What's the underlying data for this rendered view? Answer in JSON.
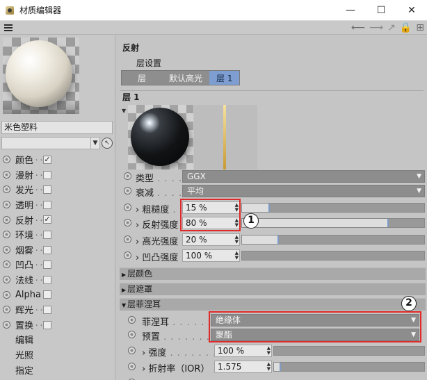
{
  "window": {
    "title": "材质编辑器",
    "minimize_glyph": "—",
    "maximize_glyph": "☐",
    "close_glyph": "✕"
  },
  "toolbar": {
    "icons": [
      "menu-icon",
      "back-arrow-icon",
      "forward-arrow-icon",
      "up-arrow-icon",
      "lock-icon",
      "new-window-icon"
    ]
  },
  "material": {
    "name": "米色塑料",
    "channels": [
      {
        "label": "颜色",
        "checked": true,
        "has_checkbox": true
      },
      {
        "label": "漫射",
        "checked": false,
        "has_checkbox": true
      },
      {
        "label": "发光",
        "checked": false,
        "has_checkbox": true
      },
      {
        "label": "透明",
        "checked": false,
        "has_checkbox": true
      },
      {
        "label": "反射",
        "checked": true,
        "has_checkbox": true
      },
      {
        "label": "环境",
        "checked": false,
        "has_checkbox": true
      },
      {
        "label": "烟雾",
        "checked": false,
        "has_checkbox": true
      },
      {
        "label": "凹凸",
        "checked": false,
        "has_checkbox": true
      },
      {
        "label": "法线",
        "checked": false,
        "has_checkbox": true
      },
      {
        "label": "Alpha",
        "checked": false,
        "has_checkbox": true
      },
      {
        "label": "辉光",
        "checked": false,
        "has_checkbox": true
      },
      {
        "label": "置换",
        "checked": false,
        "has_checkbox": true
      },
      {
        "label": "编辑",
        "has_checkbox": false
      },
      {
        "label": "光照",
        "has_checkbox": false
      },
      {
        "label": "指定",
        "has_checkbox": false
      }
    ]
  },
  "reflection": {
    "section_title": "反射",
    "layer_settings": "层设置",
    "tabs": [
      {
        "label": "层",
        "active": false
      },
      {
        "label": "默认高光",
        "active": false
      },
      {
        "label": "层 1",
        "active": true
      }
    ],
    "layer_title": "层 1",
    "type": {
      "label": "类型",
      "value": "GGX"
    },
    "attenuation": {
      "label": "衰减",
      "value": "平均"
    },
    "roughness": {
      "label": "粗糙度",
      "value": "15 %",
      "level": 0.15
    },
    "reflect_strength": {
      "label": "反射强度",
      "value": "80 %",
      "level": 0.8
    },
    "spec_strength": {
      "label": "高光强度",
      "value": "20 %",
      "level": 0.2
    },
    "bump_strength": {
      "label": "凹凸强度",
      "value": "100 %",
      "level": 1.0
    },
    "groups": {
      "layer_color": "层颜色",
      "layer_mask": "层遮罩",
      "layer_fresnel": "层菲涅耳"
    },
    "fresnel": {
      "label": "菲涅耳",
      "value": "绝缘体"
    },
    "preset": {
      "label": "预置",
      "value": "聚酯"
    },
    "strength": {
      "label": "强度",
      "value": "100 %",
      "level": 1.0
    },
    "ior": {
      "label": "折射率（IOR）",
      "value": "1.575",
      "level": 0.04
    }
  },
  "annotations": {
    "callout_1": "1",
    "callout_2": "2",
    "color": "#e02a2a"
  }
}
